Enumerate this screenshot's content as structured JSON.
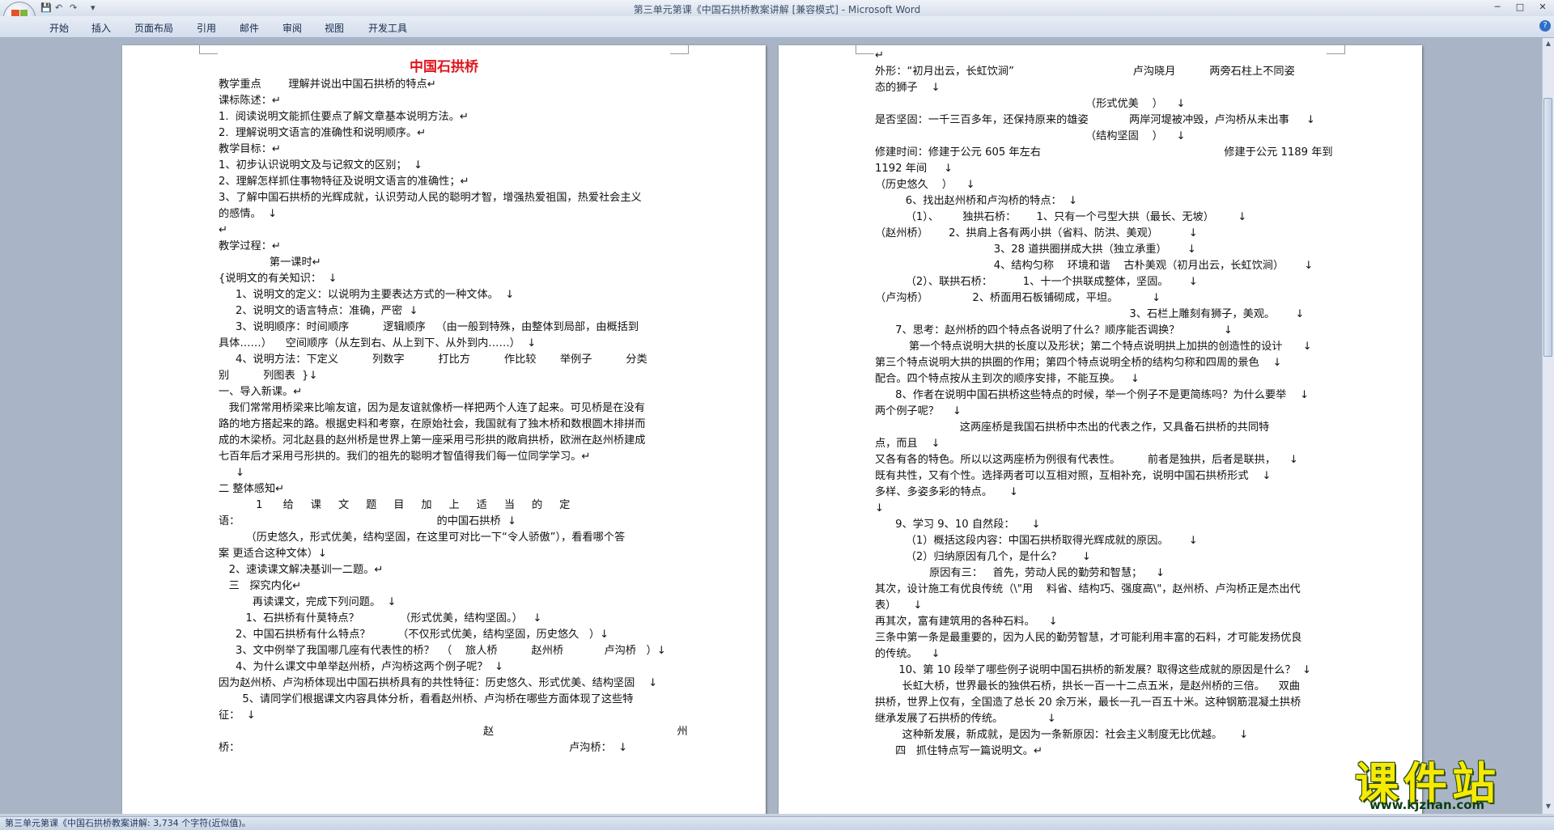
{
  "window": {
    "title": "第三单元第课《中国石拱桥教案讲解 [兼容模式] - Microsoft Word",
    "controls": [
      "─",
      "□",
      "✕"
    ]
  },
  "quick_access": {
    "save": "💾",
    "undo": "↶",
    "redo": "↷",
    "customize": "▾"
  },
  "ribbon_tabs": [
    "开始",
    "插入",
    "页面布局",
    "引用",
    "邮件",
    "审阅",
    "视图",
    "开发工具"
  ],
  "help": "?",
  "pages": {
    "left": {
      "title": "中国石拱桥",
      "lines": [
        "教学重点        理解并说出中国石拱桥的特点↵",
        "课标陈述：↵",
        "1.  阅读说明文能抓住要点了解文章基本说明方法。↵",
        "2.  理解说明文语言的准确性和说明顺序。↵",
        "教学目标：↵",
        "1、初步认识说明文及与记叙文的区别；  ↓",
        "2、理解怎样抓住事物特征及说明文语言的准确性；↵",
        "3、了解中国石拱桥的光辉成就，认识劳动人民的聪明才智，增强热爱祖国，热爱社会主义",
        "的感情。  ↓",
        "↵",
        "教学过程：↵",
        "               第一课时↵",
        "{说明文的有关知识：  ↓",
        "     1、说明文的定义：以说明为主要表达方式的一种文体。  ↓",
        "     2、说明文的语言特点：准确，严密  ↓",
        "     3、说明顺序：时间顺序          逻辑顺序   （由一般到特殊，由整体到局部，由概括到",
        "具体……）    空间顺序（从左到右、从上到下、从外到内……）  ↓",
        "     4、说明方法：下定义          列数字          打比方          作比较       举例子          分类",
        "别          列图表  }↓",
        "一、导入新课。↵",
        "   我们常常用桥梁来比喻友谊，因为是友谊就像桥一样把两个人连了起来。可见桥是在没有",
        "路的地方搭起来的路。根据史料和考察，在原始社会，我国就有了独木桥和数根圆木排拼而",
        "成的木梁桥。河北赵县的赵州桥是世界上第一座采用弓形拱的敞肩拱桥，欧洲在赵州桥建成",
        "七百年后才采用弓形拱的。我们的祖先的聪明才智值得我们每一位同学学习。↵",
        "     ↓",
        "二 整体感知↵",
        "           1      给     课     文     题     目     加     上     适     当     的     定",
        "语：                                                          的中国石拱桥  ↓",
        "        （历史悠久，形式优美，结构坚固，在这里可对比一下“令人骄傲”），看看哪个答",
        "案 更适合这种文体）↓",
        "   2、速读课文解决基训一二题。↵",
        "   三   探究内化↵",
        "          再读课文，完成下列问题。  ↓",
        "        1、石拱桥有什莫特点？            （形式优美，结构坚固。）   ↓",
        "     2、中国石拱桥有什么特点？        （不仅形式优美，结构坚固，历史悠久   ）↓",
        "     3、文中例举了我国哪几座有代表性的桥？  （    旅人桥          赵州桥            卢沟桥   ）↓",
        "     4、为什么课文中单举赵州桥，卢沟桥这两个例子呢？  ↓",
        "因为赵州桥、卢沟桥体现出中国石拱桥具有的共性特征：历史悠久、形式优美、结构坚固    ↓",
        "       5、请同学们根据课文内容具体分析，看看赵州桥、卢沟桥在哪些方面体现了这些特",
        "征：  ↓",
        "                                                                              赵                                                      州",
        "桥：                                                                                                 卢沟桥：  ↓"
      ]
    },
    "right": {
      "lines": [
        "↵",
        "外形：“初月出云，长虹饮涧”                                   卢沟晓月          两旁石柱上不同姿",
        "态的狮子    ↓",
        "                                                              （形式优美    ）    ↓",
        "是否坚固：一千三百多年，还保持原来的雄姿            两岸河堤被冲毁，卢沟桥从未出事     ↓",
        "                                                              （结构坚固    ）    ↓",
        "修建时间：修建于公元 605 年左右                                                      修建于公元 1189 年到",
        "1192 年间     ↓",
        "（历史悠久    ）    ↓",
        "         6、找出赵州桥和卢沟桥的特点：  ↓",
        "         （1）、       独拱石桥：      1、只有一个弓型大拱（最长、无坡）       ↓",
        "（赵州桥）      2、拱肩上各有两小拱（省料、防洪、美观）         ↓",
        "                                   3、28 道拱圈拼成大拱（独立承重）      ↓",
        "                                   4、结构匀称    环境和谐    古朴美观（初月出云，长虹饮涧）      ↓",
        "         （2）、联拱石桥：         1、十一个拱联成整体，坚固。      ↓",
        "（卢沟桥）             2、桥面用石板铺砌成，平坦。          ↓",
        "                                                                           3、石栏上雕刻有狮子，美观。      ↓",
        "      7、思考：赵州桥的四个特点各说明了什么？顺序能否调换？             ↓",
        "          第一个特点说明大拱的长度以及形状；第二个特点说明拱上加拱的创造性的设计      ↓",
        "第三个特点说明大拱的拱圈的作用；第四个特点说明全桥的结构匀称和四周的景色    ↓",
        "配合。四个特点按从主到次的顺序安排，不能互换。   ↓",
        "      8、作者在说明中国石拱桥这些特点的时候，举一个例子不是更简练吗？为什么要举    ↓",
        "两个例子呢？    ↓",
        "                         这两座桥是我国石拱桥中杰出的代表之作，又具备石拱桥的共同特",
        "点，而且    ↓",
        "又各有各的特色。所以以这两座桥为例很有代表性。        前者是独拱，后者是联拱，    ↓",
        "既有共性，又有个性。选择两者可以互相对照，互相补充，说明中国石拱桥形式    ↓",
        "多样、多姿多彩的特点。     ↓",
        "↓",
        "      9、学习 9、10 自然段：     ↓",
        "         （1）概括这段内容：中国石拱桥取得光辉成就的原因。      ↓",
        "         （2）归纳原因有几个，是什么？      ↓",
        "                原因有三：   首先，劳动人民的勤劳和智慧；    ↓",
        "其次，设计施工有优良传统（\\\"用    料省、结构巧、强度高\\\"，赵州桥、卢沟桥正是杰出代",
        "表）     ↓",
        "再其次，富有建筑用的各种石料。    ↓",
        "三条中第一条是最重要的，因为人民的勤劳智慧，才可能利用丰富的石料，才可能发扬优良",
        "的传统。    ↓",
        "       10、第 10 段举了哪些例子说明中国石拱桥的新发展？取得这些成就的原因是什么？  ↓",
        "        长虹大桥，世界最长的独供石桥，拱长一百一十二点五米，是赵州桥的三倍。    双曲",
        "拱桥，世界上仅有，全国造了总长 20 余万米，最长一孔一百五十米。这种钢筋混凝土拱桥",
        "继承发展了石拱桥的传统。             ↓",
        "        这种新发展，新成就，是因为一条新原因：社会主义制度无比优越。     ↓",
        "      四   抓住特点写一篇说明文。↵"
      ]
    }
  },
  "status": "第三单元第课《中国石拱桥教案讲解: 3,734 个字符(近似值)。",
  "watermark": {
    "text": "课件站",
    "url": "www.kjzhan.com"
  }
}
